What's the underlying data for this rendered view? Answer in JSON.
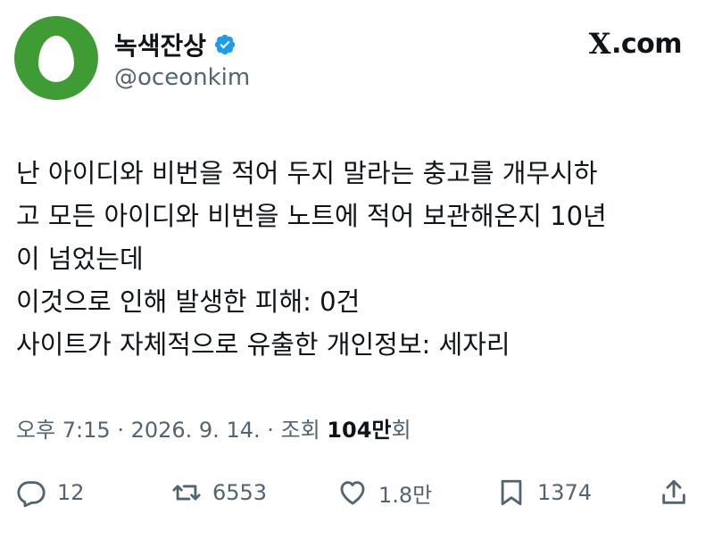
{
  "author": {
    "display_name": "녹색잔상",
    "handle": "@oceonkim",
    "avatar_color": "#3f9c35",
    "verified_icon": "verified-badge-icon",
    "verified_color": "#1d9bf0"
  },
  "site": {
    "logo_letter": "X",
    "logo_rest": ".com"
  },
  "tweet": {
    "lines": [
      "난 아이디와 비번을 적어 두지 말라는 충고를 개무시하",
      "고 모든 아이디와 비번을 노트에 적어 보관해온지 10년",
      "이 넘었는데",
      "이것으로 인해 발생한 피해: 0건",
      "사이트가 자체적으로 유출한 개인정보: 세자리"
    ]
  },
  "meta": {
    "time": "오후 7:15",
    "sep1": " · ",
    "date": "2026. 9. 14.",
    "sep2": " · ",
    "views_label": "조회 ",
    "views_value": "104만",
    "views_suffix": "회"
  },
  "actions": {
    "reply_count": "12",
    "retweet_count": "6553",
    "like_count": "1.8만",
    "bookmark_count": "1374"
  }
}
